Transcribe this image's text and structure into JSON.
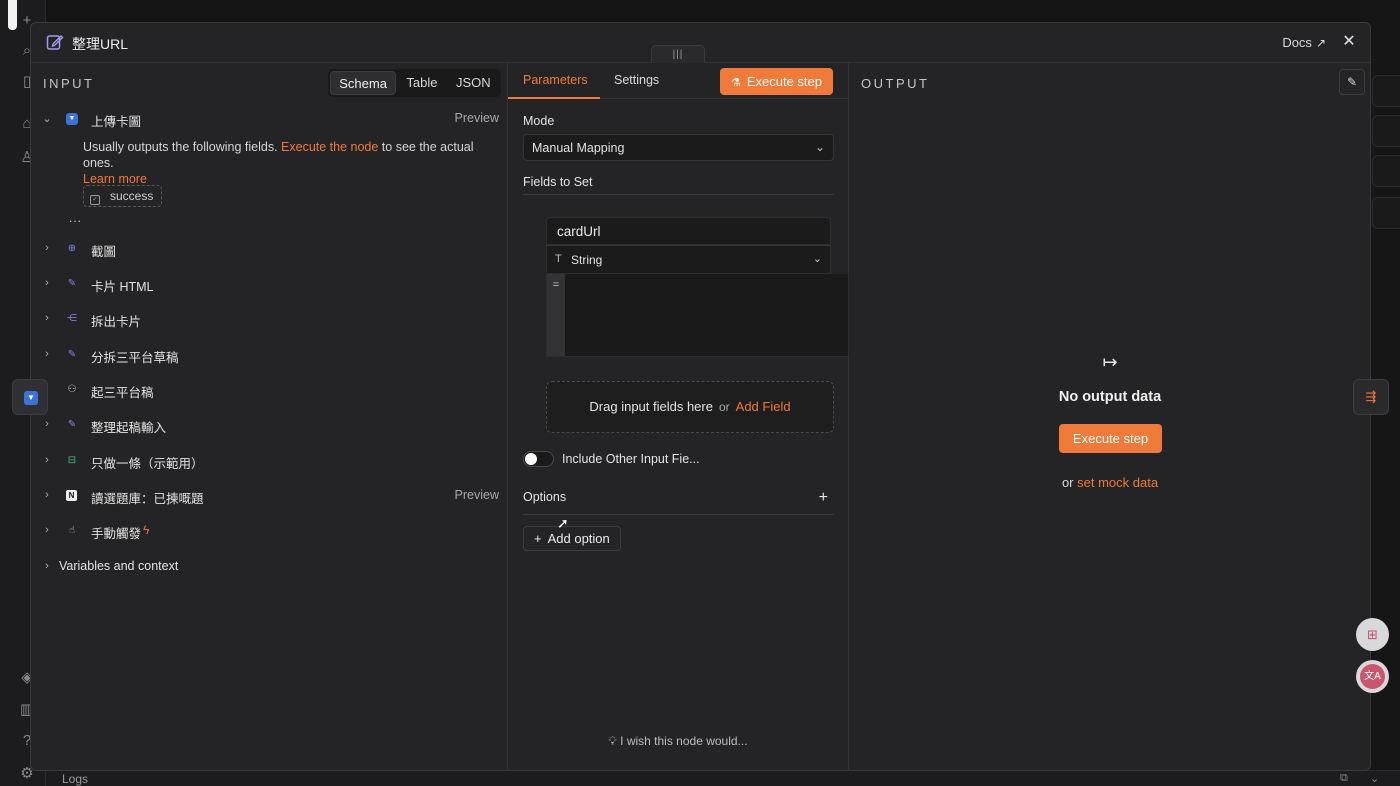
{
  "modal": {
    "title": "整理URL",
    "docs_label": "Docs",
    "close_label": "✕",
    "drag_handle": "|||"
  },
  "input": {
    "label": "INPUT",
    "views": [
      "Schema",
      "Table",
      "JSON"
    ],
    "active_view": "Schema",
    "nodes": [
      {
        "label": "上傳卡圖",
        "icon": "shield-icon",
        "expanded": true,
        "preview": "Preview"
      },
      {
        "label": "截圖",
        "icon": "globe-icon"
      },
      {
        "label": "卡片 HTML",
        "icon": "edit-icon"
      },
      {
        "label": "拆出卡片",
        "icon": "split-icon"
      },
      {
        "label": "分拆三平台草稿",
        "icon": "edit-icon"
      },
      {
        "label": "起三平台稿",
        "icon": "robot-icon"
      },
      {
        "label": "整理起稿輸入",
        "icon": "edit-icon"
      },
      {
        "label": "只做一條（示範用）",
        "icon": "limit-icon"
      },
      {
        "label": "讀選題庫：已揀嘅題",
        "icon": "notion-icon",
        "preview": "Preview"
      },
      {
        "label": "手動觸發",
        "icon": "trigger-icon"
      },
      {
        "label": "Variables and context"
      }
    ],
    "description_prefix": "Usually outputs the following fields. ",
    "description_link": "Execute the node",
    "description_suffix": " to see the actual ones.",
    "learn_more": "Learn more",
    "field_chip": "success",
    "ellipsis": "..."
  },
  "parameters": {
    "tabs": [
      "Parameters",
      "Settings"
    ],
    "active_tab": "Parameters",
    "execute_label": "Execute step",
    "mode_label": "Mode",
    "mode_value": "Manual Mapping",
    "fields_label": "Fields to Set",
    "field_name": "cardUrl",
    "field_type": "String",
    "field_type_icon": "T",
    "value_prefix": "=",
    "drop_text": "Drag input fields here",
    "drop_or": "or",
    "add_field": "Add Field",
    "include_label": "Include Other Input Fie...",
    "include_on": false,
    "options_label": "Options",
    "add_option": "Add option",
    "wish": "I wish this node would..."
  },
  "output": {
    "label": "OUTPUT",
    "no_data": "No output data",
    "execute_label": "Execute step",
    "or_text": "or",
    "mock_link": "set mock data"
  },
  "logs": {
    "label": "Logs"
  },
  "colors": {
    "accent": "#ef7a3a",
    "modal_bg": "#242426",
    "page_bg": "#141415"
  }
}
